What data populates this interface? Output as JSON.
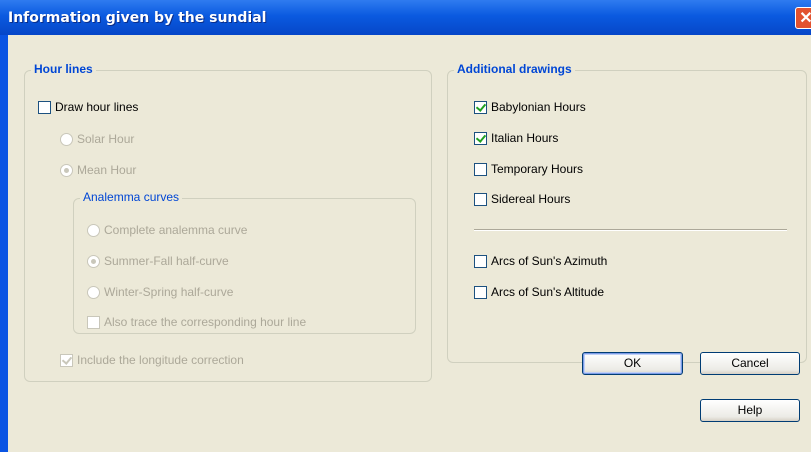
{
  "window": {
    "title": "Information given by the sundial",
    "close_symbol": "✕"
  },
  "hour_lines": {
    "legend": "Hour lines",
    "draw_hour_lines": {
      "label": "Draw hour lines",
      "checked": false
    },
    "solar_hour": {
      "label": "Solar Hour",
      "selected": false
    },
    "mean_hour": {
      "label": "Mean Hour",
      "selected": true
    },
    "analemma": {
      "legend": "Analemma curves",
      "complete": {
        "label": "Complete analemma curve",
        "selected": false
      },
      "summer_fall": {
        "label": "Summer-Fall half-curve",
        "selected": true
      },
      "winter_spring": {
        "label": "Winter-Spring half-curve",
        "selected": false
      },
      "also_trace": {
        "label": "Also trace the corresponding hour line",
        "checked": false
      }
    },
    "longitude_correction": {
      "label": "Include the longitude correction",
      "checked": true
    }
  },
  "additional": {
    "legend": "Additional drawings",
    "babylonian": {
      "label": "Babylonian Hours",
      "checked": true
    },
    "italian": {
      "label": "Italian Hours",
      "checked": true
    },
    "temporary": {
      "label": "Temporary Hours",
      "checked": false
    },
    "sidereal": {
      "label": "Sidereal Hours",
      "checked": false
    },
    "azimuth": {
      "label": "Arcs of Sun's Azimuth",
      "checked": false
    },
    "altitude": {
      "label": "Arcs of Sun's Altitude",
      "checked": false
    }
  },
  "buttons": {
    "ok": "OK",
    "cancel": "Cancel",
    "help": "Help"
  }
}
